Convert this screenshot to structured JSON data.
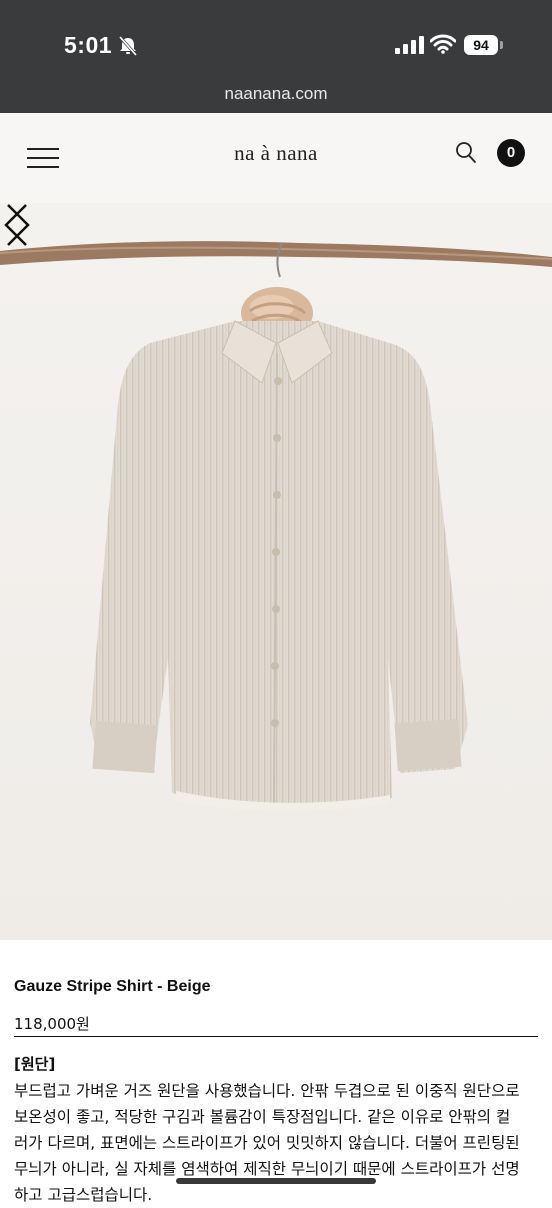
{
  "status_bar": {
    "time": "5:01",
    "battery": "94"
  },
  "browser": {
    "url": "naanana.com"
  },
  "header": {
    "logo": "na à nana",
    "cart_count": "0",
    "icons": [
      "menu-icon",
      "search-icon",
      "cart-badge"
    ]
  },
  "hero": {
    "icons": [
      "chevron-left-icon",
      "chevron-right-icon"
    ]
  },
  "product": {
    "name": "Gauze Stripe Shirt - Beige",
    "price": "118,000원",
    "section_title": "[원단]",
    "description_lines": [
      "부드럽고 가벼운 거즈 원단을 사용했습니다. 안팎 두겹으로 된 이중직 원단으로",
      "보온성이 좋고, 적당한 구김과 볼륨감이 특장점입니다. 같은 이유로 안팎의 컬",
      "러가 다르며, 표면에는 스트라이프가 있어 밋밋하지 않습니다. 더불어 프린팅된",
      "무늬가 아니라, 실 자체를 염색하여 제직한 무늬이기 때문에 스트라이프가 선명",
      "하고 고급스럽습니다."
    ]
  }
}
